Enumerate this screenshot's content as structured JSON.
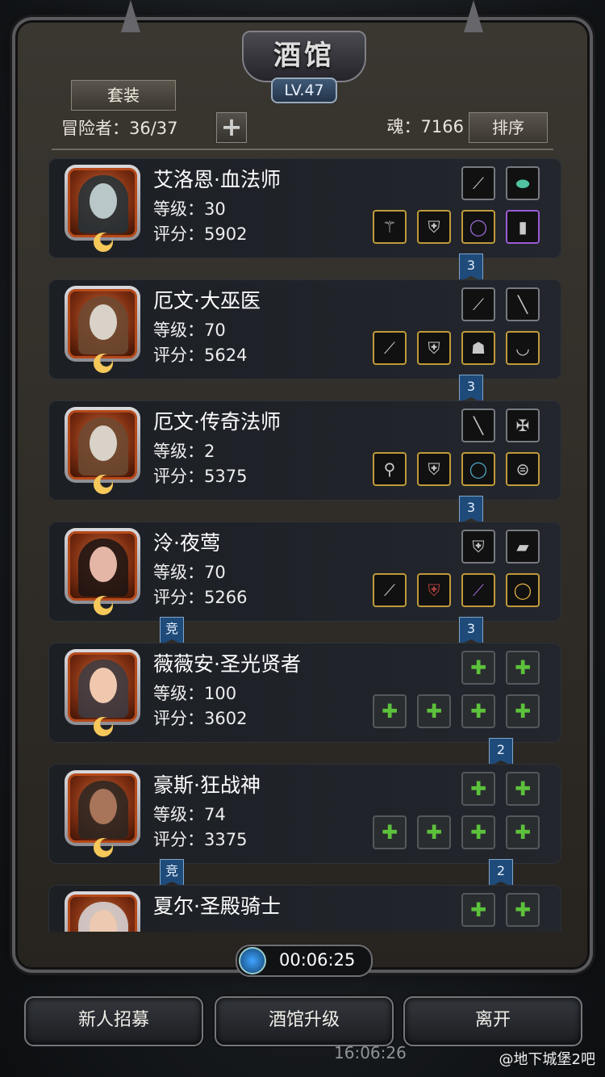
{
  "header": {
    "title": "酒馆",
    "level": "LV.47",
    "set_tab": "套装",
    "adventurers": "冒险者：36/37",
    "add_icon": "+",
    "soul": "魂：7166",
    "sort": "排序"
  },
  "cards": [
    {
      "name": "艾洛恩·血法师",
      "level": "等级：30",
      "score": "评分：5902",
      "star": "3",
      "comp": ""
    },
    {
      "name": "厄文·大巫医",
      "level": "等级：70",
      "score": "评分：5624",
      "star": "3",
      "comp": ""
    },
    {
      "name": "厄文·传奇法师",
      "level": "等级：2",
      "score": "评分：5375",
      "star": "3",
      "comp": ""
    },
    {
      "name": "泠·夜莺",
      "level": "等级：70",
      "score": "评分：5266",
      "star": "3",
      "comp": "竞"
    },
    {
      "name": "薇薇安·圣光贤者",
      "level": "等级：100",
      "score": "评分：3602",
      "star": "2",
      "comp": ""
    },
    {
      "name": "豪斯·狂战神",
      "level": "等级：74",
      "score": "评分：3375",
      "star": "2",
      "comp": "竞"
    },
    {
      "name": "夏尔·圣殿骑士",
      "level": "",
      "score": "",
      "star": "",
      "comp": ""
    }
  ],
  "timer": "00:06:25",
  "buttons": {
    "recruit": "新人招募",
    "upgrade": "酒馆升级",
    "leave": "离开"
  },
  "status_time": "16:06:26",
  "watermark": "@地下城堡2吧"
}
